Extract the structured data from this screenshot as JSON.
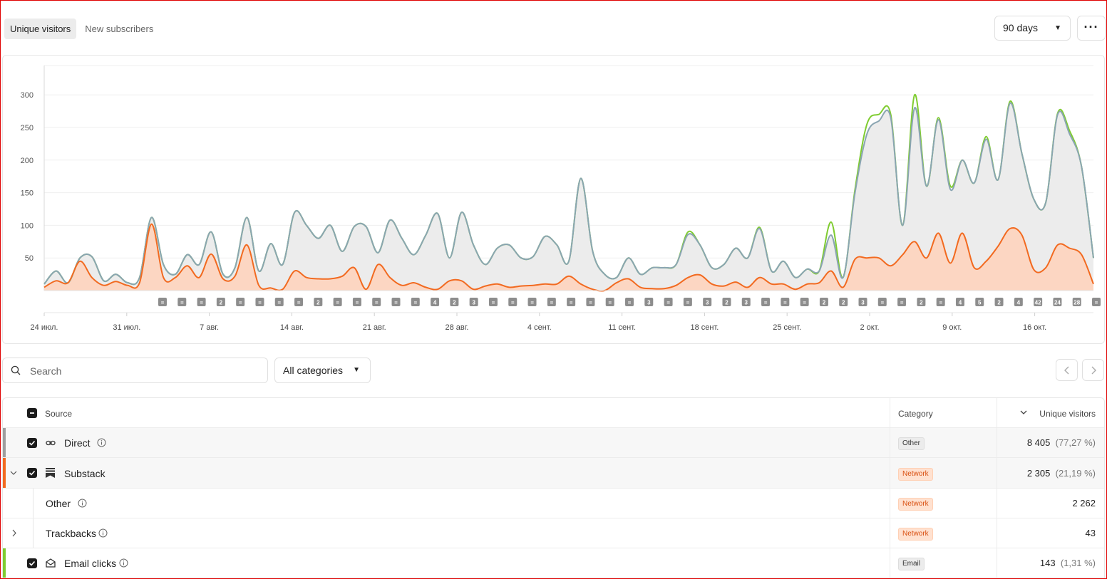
{
  "tabs": [
    {
      "label": "Unique visitors",
      "active": true
    },
    {
      "label": "New subscribers",
      "active": false
    }
  ],
  "range": {
    "label": "90 days"
  },
  "more_label": "···",
  "chart_data": {
    "type": "area",
    "ylim": [
      0,
      345
    ],
    "yticks": [
      50,
      100,
      150,
      200,
      250,
      300
    ],
    "x_tick_labels": [
      "24 июл.",
      "31 июл.",
      "7 авг.",
      "14 авг.",
      "21 авг.",
      "28 авг.",
      "4 сент.",
      "11 сент.",
      "18 сент.",
      "25 сент.",
      "2 окт.",
      "9 окт.",
      "16 окт."
    ],
    "series": [
      {
        "color": "#8aa5b2",
        "fill": "#ececec",
        "values": [
          10,
          30,
          12,
          50,
          52,
          15,
          25,
          12,
          20,
          112,
          40,
          25,
          55,
          40,
          90,
          25,
          35,
          112,
          30,
          72,
          40,
          120,
          100,
          80,
          100,
          60,
          98,
          98,
          58,
          108,
          80,
          55,
          85,
          118,
          50,
          120,
          70,
          40,
          65,
          70,
          50,
          52,
          83,
          70,
          45,
          172,
          60,
          25,
          20,
          50,
          25,
          35,
          35,
          40,
          86,
          70,
          35,
          40,
          65,
          50,
          95,
          30,
          45,
          20,
          33,
          30,
          85,
          20,
          150,
          240,
          260,
          265,
          100,
          280,
          160,
          262,
          155,
          200,
          165,
          232,
          170,
          287,
          210,
          140,
          135,
          270,
          240,
          190,
          50
        ]
      },
      {
        "color": "#7fcc30",
        "values": [
          10,
          30,
          12,
          50,
          52,
          15,
          25,
          12,
          20,
          112,
          40,
          25,
          55,
          40,
          90,
          25,
          35,
          112,
          30,
          72,
          40,
          120,
          100,
          80,
          100,
          60,
          98,
          98,
          58,
          108,
          80,
          55,
          85,
          118,
          50,
          120,
          70,
          40,
          65,
          70,
          50,
          52,
          83,
          70,
          45,
          172,
          60,
          25,
          20,
          50,
          25,
          35,
          35,
          40,
          90,
          70,
          35,
          40,
          65,
          50,
          97,
          30,
          45,
          20,
          33,
          30,
          105,
          20,
          155,
          255,
          270,
          270,
          100,
          300,
          160,
          265,
          160,
          200,
          165,
          236,
          170,
          290,
          210,
          140,
          135,
          272,
          245,
          190,
          50
        ]
      },
      {
        "color": "#f26a20",
        "fill": "#fcd6c2",
        "values": [
          5,
          15,
          12,
          45,
          20,
          8,
          14,
          8,
          12,
          102,
          20,
          20,
          38,
          20,
          56,
          18,
          22,
          70,
          8,
          4,
          2,
          30,
          20,
          18,
          18,
          22,
          35,
          2,
          40,
          20,
          8,
          12,
          5,
          2,
          15,
          15,
          2,
          7,
          10,
          5,
          7,
          8,
          10,
          10,
          22,
          10,
          2,
          0,
          12,
          18,
          5,
          3,
          3,
          8,
          20,
          24,
          10,
          7,
          13,
          5,
          20,
          10,
          10,
          2,
          10,
          12,
          30,
          5,
          48,
          50,
          50,
          38,
          55,
          75,
          50,
          88,
          42,
          88,
          35,
          45,
          68,
          95,
          85,
          32,
          35,
          70,
          65,
          55,
          10
        ]
      }
    ],
    "annotations": [
      "≡",
      "≡",
      "≡",
      "2",
      "≡",
      "≡",
      "≡",
      "≡",
      "2",
      "≡",
      "≡",
      "≡",
      "≡",
      "≡",
      "4",
      "2",
      "3",
      "≡",
      "≡",
      "≡",
      "≡",
      "≡",
      "≡",
      "≡",
      "≡",
      "3",
      "≡",
      "≡",
      "3",
      "2",
      "3",
      "≡",
      "≡",
      "≡",
      "2",
      "2",
      "3",
      "≡",
      "≡",
      "2",
      "≡",
      "4",
      "5",
      "2",
      "4",
      "42",
      "24",
      "28",
      "≡"
    ]
  },
  "search": {
    "placeholder": "Search"
  },
  "category_filter": {
    "label": "All categories"
  },
  "table": {
    "headers": {
      "source": "Source",
      "category": "Category",
      "visitors": "Unique visitors"
    },
    "rows": [
      {
        "name": "Direct",
        "category": "Other",
        "count": "8 405",
        "pct": "(77,27 %)",
        "color": "#9e9e9e"
      },
      {
        "name": "Substack",
        "category": "Network",
        "count": "2 305",
        "pct": "(21,19 %)",
        "color": "#f26a20"
      },
      {
        "name": "Other",
        "category": "Network",
        "count": "2 262",
        "pct": ""
      },
      {
        "name": "Trackbacks",
        "category": "Network",
        "count": "43",
        "pct": ""
      },
      {
        "name": "Email clicks",
        "category": "Email",
        "count": "143",
        "pct": "(1,31 %)",
        "color": "#7fcc30"
      }
    ]
  }
}
